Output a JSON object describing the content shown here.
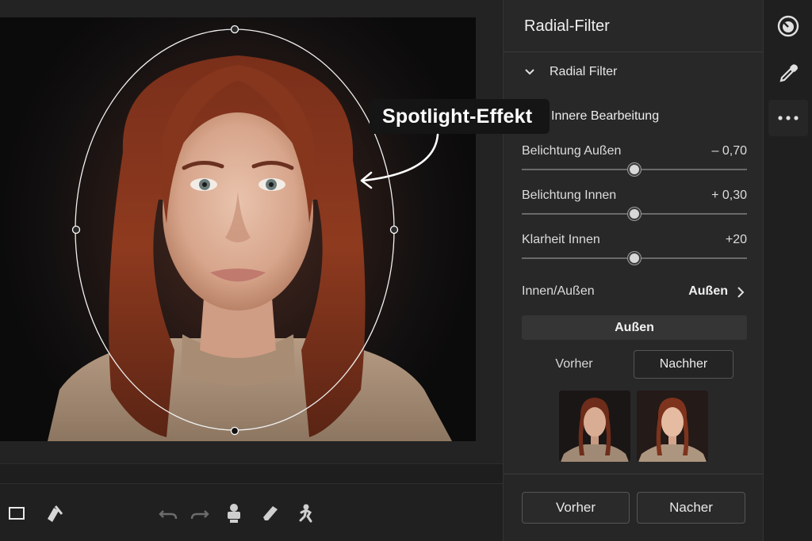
{
  "panel": {
    "title": "Radial-Filter",
    "section_label": "Radial Filter",
    "subsection_label": "Innere Bearbeitung",
    "sliders": [
      {
        "label": "Belichtung Außen",
        "value_text": "– 0,70",
        "value": -0.7
      },
      {
        "label": "Belichtung Innen",
        "value_text": "+ 0,30",
        "value": 0.3
      },
      {
        "label": "Klarheit Innen",
        "value_text": "+20",
        "value": 20
      }
    ],
    "inout": {
      "label": "Innen/Außen",
      "value": "Außen"
    },
    "aussen_button": "Außen",
    "compare_tabs": {
      "before": "Vorher",
      "after": "Nachher",
      "selected": "Nachher"
    },
    "footer": {
      "before_button": "Vorher",
      "after_button": "Nacher"
    }
  },
  "canvas": {
    "callout": "Spotlight-Effekt"
  },
  "toolbar_icons": [
    "crop-icon",
    "brush-icon",
    "undo-icon",
    "redo-icon",
    "stamp-icon",
    "eraser-icon",
    "figure-icon"
  ],
  "tool_rail_icons": [
    "radial-filter-icon",
    "eyedropper-icon",
    "more-icon"
  ],
  "colors": {
    "panel_bg": "#282828",
    "rail_bg": "#1f1f1f",
    "canvas_bg": "#232323",
    "callout_bg": "#151515",
    "button_bg": "#353535"
  }
}
